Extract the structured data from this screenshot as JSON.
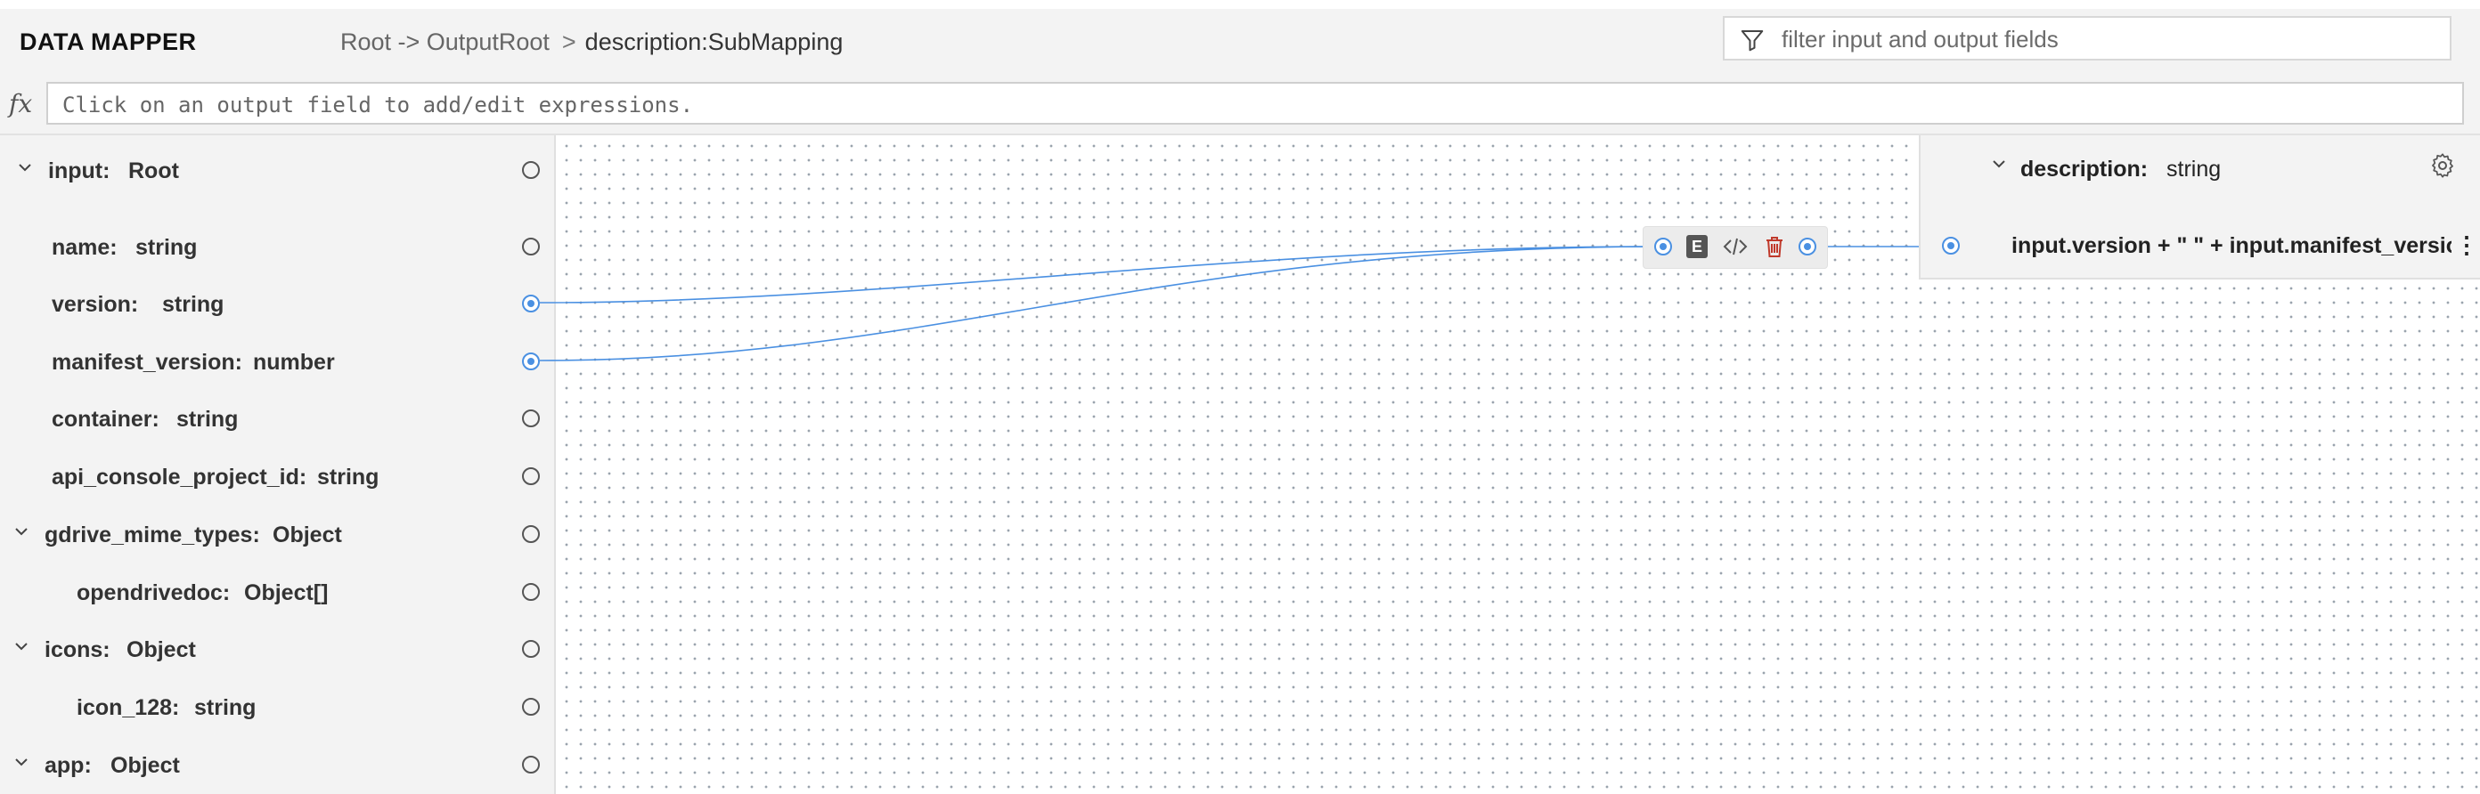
{
  "header": {
    "app_title": "DATA MAPPER",
    "breadcrumb_path": "Root -> OutputRoot",
    "breadcrumb_separator": ">",
    "breadcrumb_current": "description:SubMapping",
    "filter_placeholder": "filter input and output fields"
  },
  "expression_bar": {
    "fx_label": "fx",
    "placeholder": "Click on an output field to add/edit expressions."
  },
  "input": {
    "root_name": "input:",
    "root_type": "Root",
    "fields": [
      {
        "name": "name:",
        "type": "string",
        "connected": false
      },
      {
        "name": "version:",
        "type": "string",
        "connected": true
      },
      {
        "name": "manifest_version:",
        "type": "number",
        "connected": true
      },
      {
        "name": "container:",
        "type": "string",
        "connected": false
      },
      {
        "name": "api_console_project_id:",
        "type": "string",
        "connected": false
      },
      {
        "name": "gdrive_mime_types:",
        "type": "Object",
        "connected": false,
        "expandable": true
      },
      {
        "name": "opendrivedoc:",
        "type": "Object[]",
        "connected": false
      },
      {
        "name": "icons:",
        "type": "Object",
        "connected": false,
        "expandable": true
      },
      {
        "name": "icon_128:",
        "type": "string",
        "connected": false
      },
      {
        "name": "app:",
        "type": "Object",
        "connected": false,
        "expandable": true
      }
    ]
  },
  "mapping_node": {
    "badge": "E",
    "code_icon": "code-icon",
    "delete_icon": "trash-icon"
  },
  "output": {
    "field_name": "description:",
    "field_type": "string",
    "expression": "input.version + \" \" + input.manifest_version",
    "menu_glyph": "⋮"
  },
  "colors": {
    "link": "#4a90e2",
    "panel_bg": "#f3f3f3",
    "delete": "#c0392b"
  }
}
